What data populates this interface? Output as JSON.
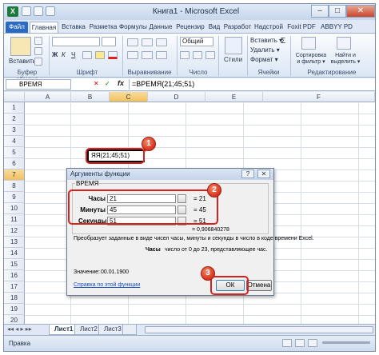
{
  "window": {
    "title": "Книга1 - Microsoft Excel",
    "app_icon": "X",
    "minimize": "–",
    "maximize": "□",
    "close": "✕"
  },
  "ribbon_tabs": [
    "Файл",
    "Главная",
    "Вставка",
    "Разметка",
    "Формулы",
    "Данные",
    "Рецензир",
    "Вид",
    "Разработ",
    "Надстрой",
    "Foxit PDF",
    "ABBYY PD"
  ],
  "ribbon": {
    "paste_label": "Вставить",
    "font_label": "Шрифт",
    "clipboard_label": "Буфер обмена",
    "alignment_label": "Выравнивание",
    "number_label": "Число",
    "styles_label": "Стили",
    "cells_label": "Ячейки",
    "sort_label": "Сортировка и фильтр ▾",
    "find_label": "Найти и выделить ▾",
    "editing_label": "Редактирование",
    "insert_btn": "Вставить ▾",
    "delete_btn": "Удалить ▾",
    "format_btn": "Формат ▾",
    "number_format": "Общий"
  },
  "formula_bar": {
    "name_box": "ВРЕМЯ",
    "fx": "fx",
    "formula": "=ВРЕМЯ(21;45;51)"
  },
  "grid": {
    "columns": [
      "A",
      "B",
      "C",
      "D",
      "E",
      "F"
    ],
    "rows": [
      "1",
      "2",
      "3",
      "4",
      "5",
      "6",
      "7",
      "8",
      "9",
      "10",
      "11",
      "12",
      "13",
      "14",
      "15",
      "16",
      "17",
      "18",
      "19",
      "20"
    ],
    "selected_column": "C",
    "selected_row": "7",
    "active_cell_text": "ЯЯ(21;45;51)"
  },
  "dialog": {
    "title": "Аргументы функции",
    "help_btn": "?",
    "close_btn": "✕",
    "function_name": "ВРЕМЯ",
    "args": [
      {
        "label": "Часы",
        "value": "21",
        "result": "21"
      },
      {
        "label": "Минуты",
        "value": "45",
        "result": "45"
      },
      {
        "label": "Секунды",
        "value": "51",
        "result": "51"
      }
    ],
    "result_value": "= 0,906840278",
    "description": "Преобразует заданные в виде чисел часы, минуты и секунды в число в коде времени Excel.",
    "arg_help_name": "Часы",
    "arg_help_text": "число от 0 до 23, представляющее час.",
    "value_label": "Значение:",
    "value_result": "00.01.1900",
    "help_link": "Справка по этой функции",
    "ok": "ОК",
    "cancel": "Отмена"
  },
  "callouts": [
    "1",
    "2",
    "3"
  ],
  "sheets": [
    "Лист1",
    "Лист2",
    "Лист3"
  ],
  "status": {
    "mode": "Правка"
  },
  "colors": {
    "accent": "#2a6ac2",
    "callout_red": "#d9201f",
    "excel_green": "#1d7a3d"
  }
}
